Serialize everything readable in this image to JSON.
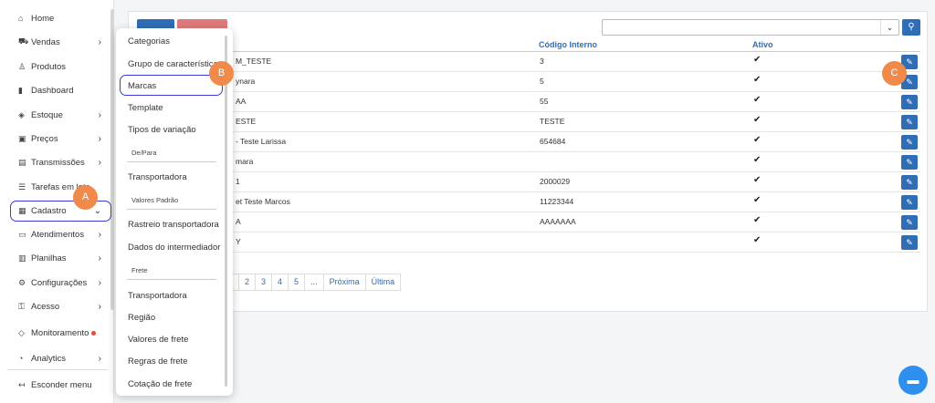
{
  "sidebar": {
    "items": [
      {
        "label": "Home",
        "icon": "home-icon",
        "glyph": "⌂",
        "chevron": false
      },
      {
        "label": "Vendas",
        "icon": "cart-icon",
        "glyph": "⛟",
        "chevron": true
      },
      {
        "label": "Produtos",
        "icon": "shirt-icon",
        "glyph": "♙",
        "chevron": false
      },
      {
        "label": "Dashboard",
        "icon": "bar-chart-icon",
        "glyph": "▮",
        "chevron": false
      },
      {
        "label": "Estoque",
        "icon": "box-icon",
        "glyph": "◈",
        "chevron": true
      },
      {
        "label": "Preços",
        "icon": "money-icon",
        "glyph": "▣",
        "chevron": true
      },
      {
        "label": "Transmissões",
        "icon": "transmission-icon",
        "glyph": "▤",
        "chevron": true
      },
      {
        "label": "Tarefas em lote",
        "icon": "list-icon",
        "glyph": "☰",
        "chevron": false
      },
      {
        "label": "Cadastro",
        "icon": "clipboard-icon",
        "glyph": "▦",
        "chevron": true
      },
      {
        "label": "Atendimentos",
        "icon": "chat-icon",
        "glyph": "▭",
        "chevron": true
      },
      {
        "label": "Planilhas",
        "icon": "spreadsheet-icon",
        "glyph": "▥",
        "chevron": true
      },
      {
        "label": "Configurações",
        "icon": "gear-icon",
        "glyph": "⚙",
        "chevron": true
      },
      {
        "label": "Acesso",
        "icon": "lock-icon",
        "glyph": "⚿",
        "chevron": true
      },
      {
        "label": "Monitoramento",
        "icon": "diamond-icon",
        "glyph": "◇",
        "chevron": false,
        "dot": true
      },
      {
        "label": "Analytics",
        "icon": "analytics-icon",
        "glyph": "◔",
        "chevron": true
      }
    ],
    "hide_menu": "Esconder menu"
  },
  "table": {
    "headers": {
      "code": "Código Interno",
      "active": "Ativo"
    },
    "rows": [
      {
        "name": "M_TESTE",
        "code": "3"
      },
      {
        "name": "ynara",
        "code": "5"
      },
      {
        "name": "AA",
        "code": "55"
      },
      {
        "name": "ESTE",
        "code": "TESTE"
      },
      {
        "name": "- Teste Larissa",
        "code": "654684"
      },
      {
        "name": "mara",
        "code": ""
      },
      {
        "name": "1",
        "code": "2000029"
      },
      {
        "name": "et Teste Marcos",
        "code": "11223344"
      },
      {
        "name": "A",
        "code": "AAAAAAA"
      },
      {
        "name": "Y",
        "code": ""
      }
    ]
  },
  "pagination": [
    "2",
    "3",
    "4",
    "5",
    "...",
    "Próxima",
    "Última"
  ],
  "dropdown": {
    "categorias": "Categorias",
    "grupo": "Grupo de características",
    "marcas": "Marcas",
    "template": "Template",
    "tipos": "Tipos de variação",
    "depara": "De/Para",
    "transportadora1": "Transportadora",
    "valores_padrao": "Valores Padrão",
    "rastreio": "Rastreio transportadora",
    "dados": "Dados do intermediador",
    "frete": "Frete",
    "transportadora2": "Transportadora",
    "regiao": "Região",
    "valores_frete": "Valores de frete",
    "regras_frete": "Regras de frete",
    "cotacao": "Cotação de frete"
  },
  "markers": {
    "a": "A",
    "b": "B",
    "c": "C"
  },
  "colors": {
    "primary": "#2f6db5",
    "highlight": "#3a3ad6",
    "marker": "#f08a4b",
    "danger": "#e07a7a"
  }
}
